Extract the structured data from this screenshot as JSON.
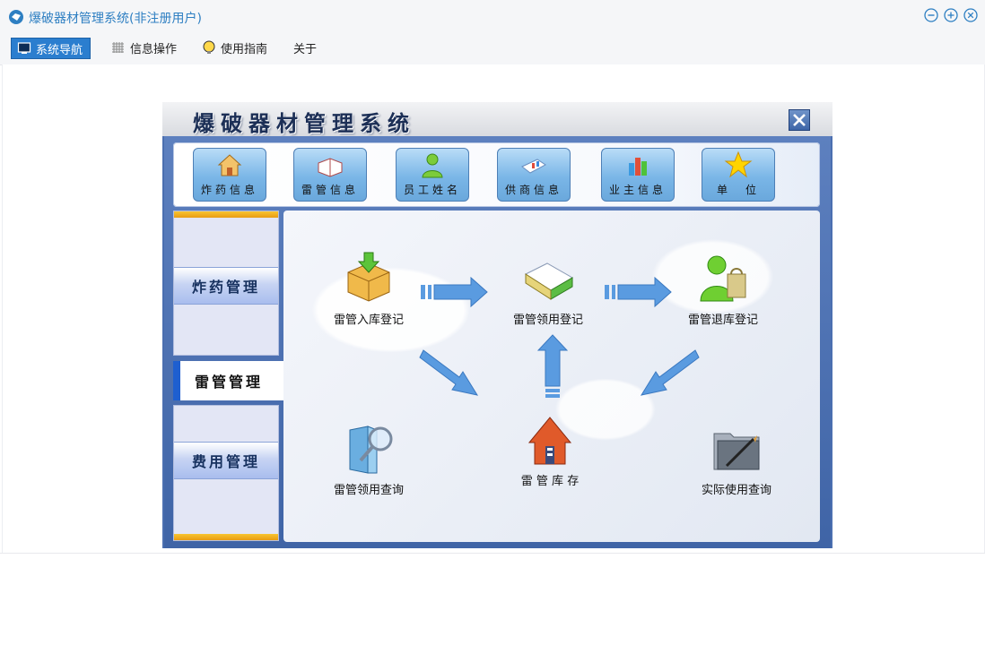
{
  "window": {
    "title": "爆破器材管理系统(非注册用户)"
  },
  "menu": [
    {
      "label": "系统导航",
      "active": true
    },
    {
      "label": "信息操作",
      "active": false
    },
    {
      "label": "使用指南",
      "active": false
    },
    {
      "label": "关于",
      "active": false
    }
  ],
  "inner": {
    "title": "爆破器材管理系统",
    "toolbar": [
      "炸药信息",
      "雷管信息",
      "员工姓名",
      "供商信息",
      "业主信息",
      "单　位"
    ],
    "side_nav": {
      "top": "炸药管理",
      "active": "雷管管理",
      "bottom": "费用管理"
    },
    "workflow": {
      "in_register": "雷管入库登记",
      "use_register": "雷管领用登记",
      "return_register": "雷管退库登记",
      "use_query": "雷管领用查询",
      "stock": "雷 管 库 存",
      "actual_query": "实际使用查询"
    }
  },
  "colors": {
    "accent": "#2b7ecf",
    "title_text": "#2e7fc2",
    "inner_frame": "#4b6fb0",
    "arrow": "#5a9be0"
  }
}
